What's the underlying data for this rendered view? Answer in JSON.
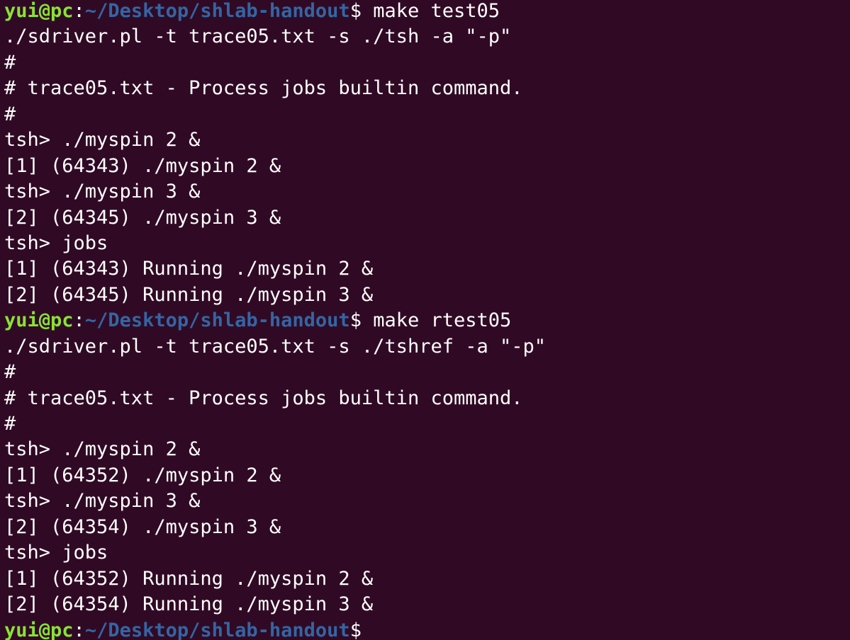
{
  "colors": {
    "background": "#300a24",
    "text": "#ffffff",
    "prompt_user": "#8ae234",
    "prompt_path": "#3465a4"
  },
  "prompt": {
    "user": "yui@pc",
    "path": "~/Desktop/shlab-handout",
    "symbol": "$"
  },
  "lines": [
    {
      "type": "prompt",
      "command": " make test05"
    },
    {
      "type": "text",
      "text": "./sdriver.pl -t trace05.txt -s ./tsh -a \"-p\""
    },
    {
      "type": "text",
      "text": "#"
    },
    {
      "type": "text",
      "text": "# trace05.txt - Process jobs builtin command."
    },
    {
      "type": "text",
      "text": "#"
    },
    {
      "type": "text",
      "text": "tsh> ./myspin 2 &"
    },
    {
      "type": "text",
      "text": "[1] (64343) ./myspin 2 &"
    },
    {
      "type": "text",
      "text": "tsh> ./myspin 3 &"
    },
    {
      "type": "text",
      "text": "[2] (64345) ./myspin 3 &"
    },
    {
      "type": "text",
      "text": "tsh> jobs"
    },
    {
      "type": "text",
      "text": "[1] (64343) Running ./myspin 2 &"
    },
    {
      "type": "text",
      "text": "[2] (64345) Running ./myspin 3 &"
    },
    {
      "type": "prompt",
      "command": " make rtest05"
    },
    {
      "type": "text",
      "text": "./sdriver.pl -t trace05.txt -s ./tshref -a \"-p\""
    },
    {
      "type": "text",
      "text": "#"
    },
    {
      "type": "text",
      "text": "# trace05.txt - Process jobs builtin command."
    },
    {
      "type": "text",
      "text": "#"
    },
    {
      "type": "text",
      "text": "tsh> ./myspin 2 &"
    },
    {
      "type": "text",
      "text": "[1] (64352) ./myspin 2 &"
    },
    {
      "type": "text",
      "text": "tsh> ./myspin 3 &"
    },
    {
      "type": "text",
      "text": "[2] (64354) ./myspin 3 &"
    },
    {
      "type": "text",
      "text": "tsh> jobs"
    },
    {
      "type": "text",
      "text": "[1] (64352) Running ./myspin 2 &"
    },
    {
      "type": "text",
      "text": "[2] (64354) Running ./myspin 3 &"
    },
    {
      "type": "prompt",
      "command": ""
    }
  ]
}
